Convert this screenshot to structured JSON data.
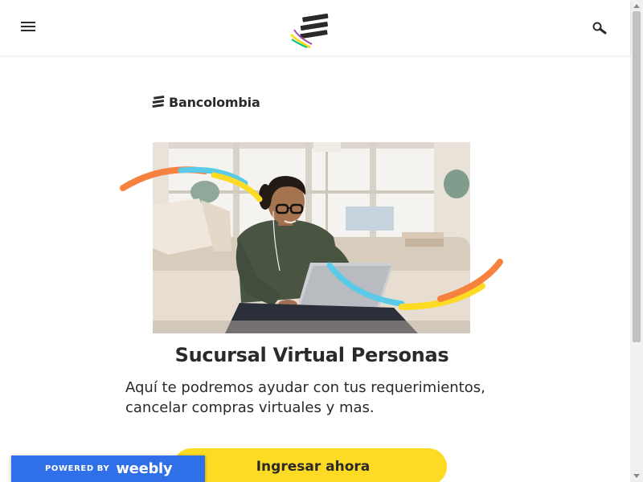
{
  "header": {
    "menu_icon": "hamburger-menu-icon",
    "logo_icon": "bancolombia-symbol-icon",
    "search_icon": "search-icon"
  },
  "brand": {
    "name": "Bancolombia",
    "logo_icon": "bancolombia-symbol-icon"
  },
  "hero": {
    "image": "woman-with-laptop-photo"
  },
  "main": {
    "title": "Sucursal Virtual Personas",
    "description": "Aquí te podremos ayudar con tus requerimientos, cancelar compras virtuales y mas.",
    "cta_label": "Ingresar ahora"
  },
  "badge": {
    "powered": "POWERED BY",
    "name": "weebly"
  },
  "colors": {
    "brand_yellow": "#fdda24",
    "text_dark": "#2c2a29",
    "arc_orange": "#f7813e",
    "arc_blue": "#59cbe8",
    "arc_yellow": "#fdda24",
    "arc_purple": "#9b52b4",
    "arc_green": "#00c389",
    "weebly_blue": "#2f6fe8"
  }
}
